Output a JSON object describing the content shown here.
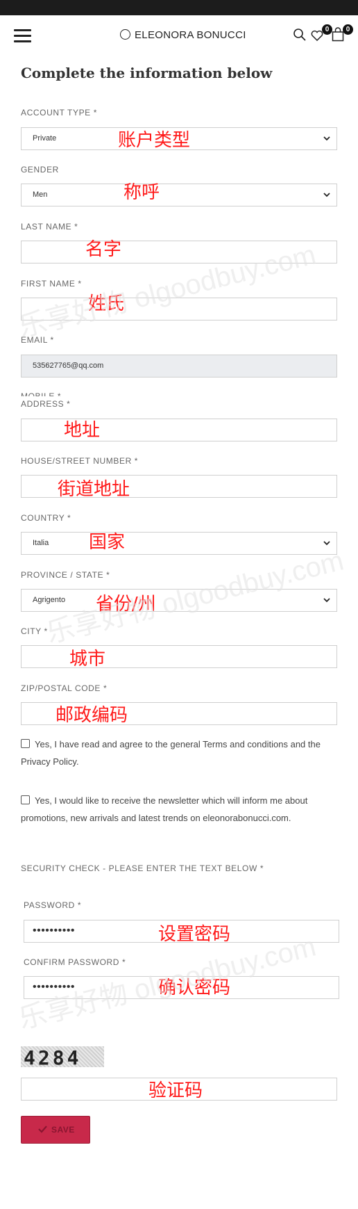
{
  "header": {
    "logo_text": "ELEONORA BONUCCI",
    "wishlist_count": "0",
    "cart_count": "0"
  },
  "page_title": "Complete the information below",
  "form": {
    "account_type": {
      "label": "ACCOUNT TYPE *",
      "value": "Private",
      "annotation": "账户类型"
    },
    "gender": {
      "label": "GENDER",
      "value": "Men",
      "annotation": "称呼"
    },
    "last_name": {
      "label": "LAST NAME *",
      "value": "",
      "annotation": "名字"
    },
    "first_name": {
      "label": "FIRST NAME *",
      "value": "",
      "annotation": "姓氏"
    },
    "email": {
      "label": "EMAIL *",
      "value": "535627765@qq.com"
    },
    "mobile": {
      "label": "MOBILE *"
    },
    "address": {
      "label": "ADDRESS *",
      "value": "",
      "annotation": "地址"
    },
    "house_number": {
      "label": "HOUSE/STREET NUMBER *",
      "value": "",
      "annotation": "街道地址"
    },
    "country": {
      "label": "COUNTRY *",
      "value": "Italia",
      "annotation": "国家"
    },
    "province": {
      "label": "PROVINCE / STATE *",
      "value": "Agrigento",
      "annotation": "省份/州"
    },
    "city": {
      "label": "CITY *",
      "value": "",
      "annotation": "城市"
    },
    "zip": {
      "label": "ZIP/POSTAL CODE *",
      "value": "",
      "annotation": "邮政编码"
    },
    "terms_text": "Yes, I have read and agree to the general Terms and conditions and the Privacy Policy.",
    "newsletter_text": "Yes, I would like to receive the newsletter which will inform me about promotions, new arrivals and latest trends on eleonorabonucci.com.",
    "security_label": "SECURITY CHECK - PLEASE ENTER THE TEXT BELOW *",
    "password": {
      "label": "PASSWORD *",
      "value": "••••••••••",
      "annotation": "设置密码"
    },
    "confirm_password": {
      "label": "CONFIRM PASSWORD *",
      "value": "••••••••••",
      "annotation": "确认密码"
    },
    "captcha_text": "4284",
    "captcha_annotation": "验证码",
    "save_label": "SAVE"
  },
  "watermarks": [
    "乐享好物 olgoodbuy.com",
    "乐享好物 olgoodbuy.com",
    "乐享好物 olgoodbuy.com"
  ]
}
